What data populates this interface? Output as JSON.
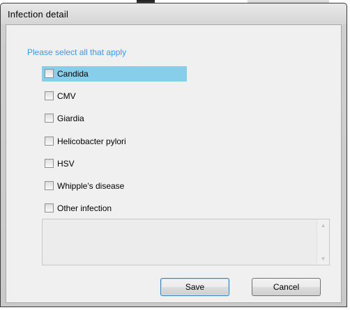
{
  "window": {
    "title": "Infection detail"
  },
  "prompt": "Please select all that apply",
  "options": [
    {
      "label": "Candida",
      "checked": false,
      "selected": true
    },
    {
      "label": "CMV",
      "checked": false,
      "selected": false
    },
    {
      "label": "Giardia",
      "checked": false,
      "selected": false
    },
    {
      "label": "Helicobacter pylori",
      "checked": false,
      "selected": false
    },
    {
      "label": "HSV",
      "checked": false,
      "selected": false
    },
    {
      "label": "Whipple's disease",
      "checked": false,
      "selected": false
    },
    {
      "label": "Other infection",
      "checked": false,
      "selected": false
    }
  ],
  "other_text": {
    "value": ""
  },
  "buttons": {
    "save": "Save",
    "cancel": "Cancel"
  },
  "colors": {
    "prompt": "#3399ff",
    "selection": "#87ceeb"
  },
  "icons": {
    "scroll_up": "scroll-up-arrow-icon",
    "scroll_down": "scroll-down-arrow-icon"
  }
}
